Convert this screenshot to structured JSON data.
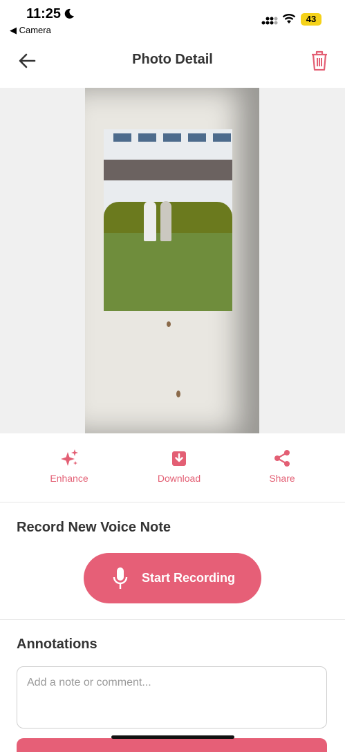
{
  "status_bar": {
    "time": "11:25",
    "back_app": "◀ Camera",
    "battery": "43"
  },
  "header": {
    "title": "Photo Detail"
  },
  "actions": [
    {
      "label": "Enhance",
      "icon": "sparkles-icon"
    },
    {
      "label": "Download",
      "icon": "download-icon"
    },
    {
      "label": "Share",
      "icon": "share-icon"
    }
  ],
  "voice": {
    "title": "Record New Voice Note",
    "button_label": "Start Recording"
  },
  "annotations": {
    "title": "Annotations",
    "placeholder": "Add a note or comment..."
  },
  "colors": {
    "accent": "#e65f77",
    "accent_text": "#e35f74"
  }
}
